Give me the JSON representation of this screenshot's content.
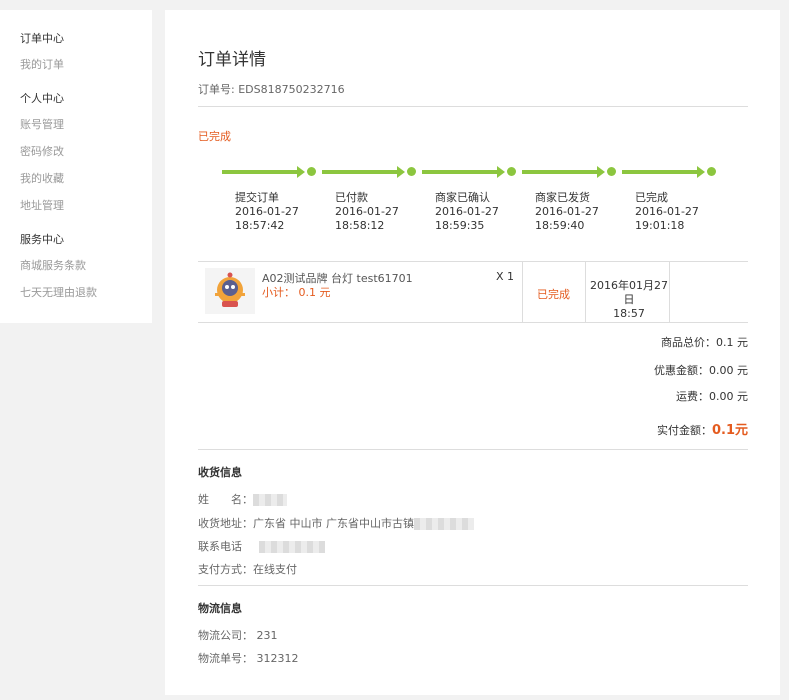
{
  "sidebar": {
    "groups": [
      {
        "title": "订单中心",
        "items": [
          "我的订单"
        ]
      },
      {
        "title": "个人中心",
        "items": [
          "账号管理",
          "密码修改",
          "我的收藏",
          "地址管理"
        ]
      },
      {
        "title": "服务中心",
        "items": [
          "商城服务条款",
          "七天无理由退款"
        ]
      }
    ]
  },
  "order": {
    "title": "订单详情",
    "number_label": "订单号: EDS818750232716",
    "status": "已完成",
    "accent_color": "#e45b1f",
    "progress_color": "#8cc63f",
    "steps": [
      {
        "name": "提交订单",
        "date": "2016-01-27",
        "time": "18:57:42"
      },
      {
        "name": "已付款",
        "date": "2016-01-27",
        "time": "18:58:12"
      },
      {
        "name": "商家已确认",
        "date": "2016-01-27",
        "time": "18:59:35"
      },
      {
        "name": "商家已发货",
        "date": "2016-01-27",
        "time": "18:59:40"
      },
      {
        "name": "已完成",
        "date": "2016-01-27",
        "time": "19:01:18"
      }
    ]
  },
  "goods": {
    "name": "A02测试品牌 台灯  test61701",
    "subtotal": "小计： 0.1 元",
    "qty": "X 1",
    "status": "已完成",
    "time_line1": "2016年01月27日",
    "time_line2": "18:57"
  },
  "summary": {
    "goods_total": "商品总价：0.1 元",
    "discount": "优惠金额：0.00 元",
    "shipping": "运费：0.00 元",
    "paid_label": "实付金额：",
    "paid_value": "0.1元"
  },
  "delivery": {
    "title": "收货信息",
    "name_label": "姓　　名：",
    "address_label": "收货地址：",
    "address_value": "广东省 中山市 广东省中山市古镇",
    "phone_label": "联系电话",
    "payment_label": "支付方式：",
    "payment_value": "在线支付"
  },
  "logistics": {
    "title": "物流信息",
    "company": "物流公司： 231",
    "tracking": "物流单号： 312312"
  }
}
